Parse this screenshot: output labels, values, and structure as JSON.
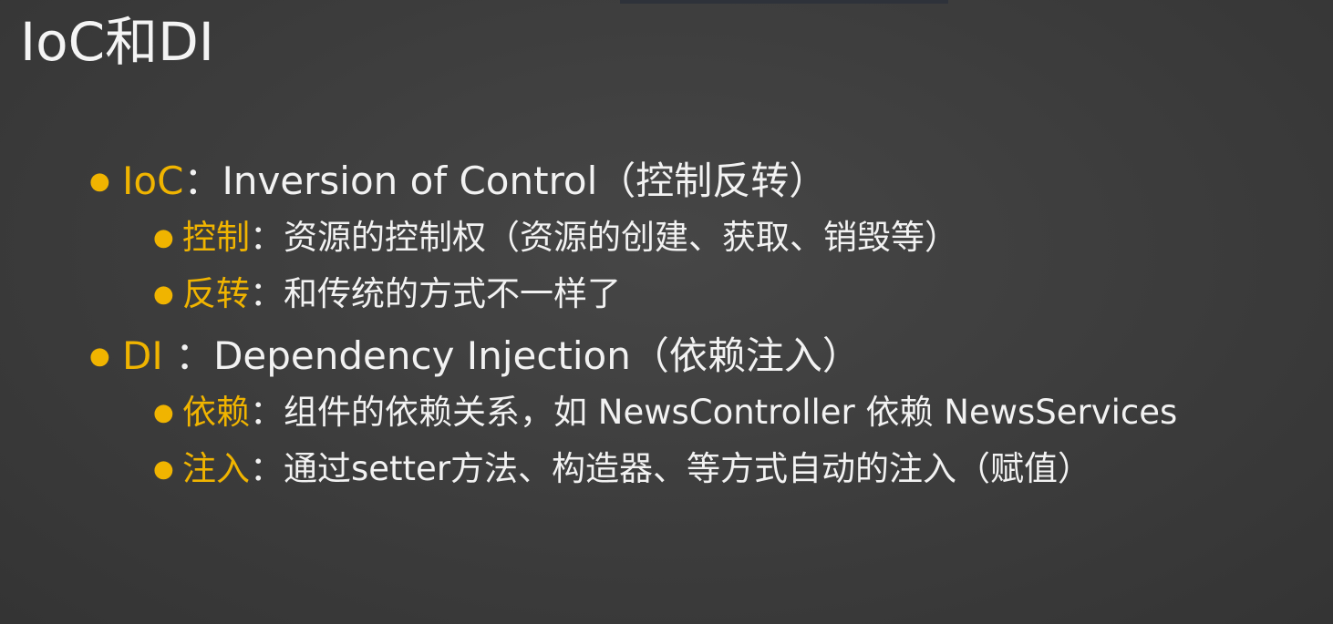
{
  "title": "IoC和DI",
  "colors": {
    "background": "#3a3a3a",
    "accent": "#f0b400",
    "text": "#f2f2f2"
  },
  "bullets": [
    {
      "key": "IoC",
      "separator": "：",
      "text": "Inversion of Control（控制反转）",
      "children": [
        {
          "key": "控制",
          "separator": "：",
          "text": "资源的控制权（资源的创建、获取、销毁等）"
        },
        {
          "key": "反转",
          "separator": "：",
          "text": "和传统的方式不一样了"
        }
      ]
    },
    {
      "key": "DI",
      "separator": " ：",
      "text": "Dependency Injection（依赖注入）",
      "children": [
        {
          "key": "依赖",
          "separator": "：",
          "text": "组件的依赖关系，如 NewsController 依赖 NewsServices"
        },
        {
          "key": "注入",
          "separator": "：",
          "text": "通过setter方法、构造器、等方式自动的注入（赋值）"
        }
      ]
    }
  ]
}
